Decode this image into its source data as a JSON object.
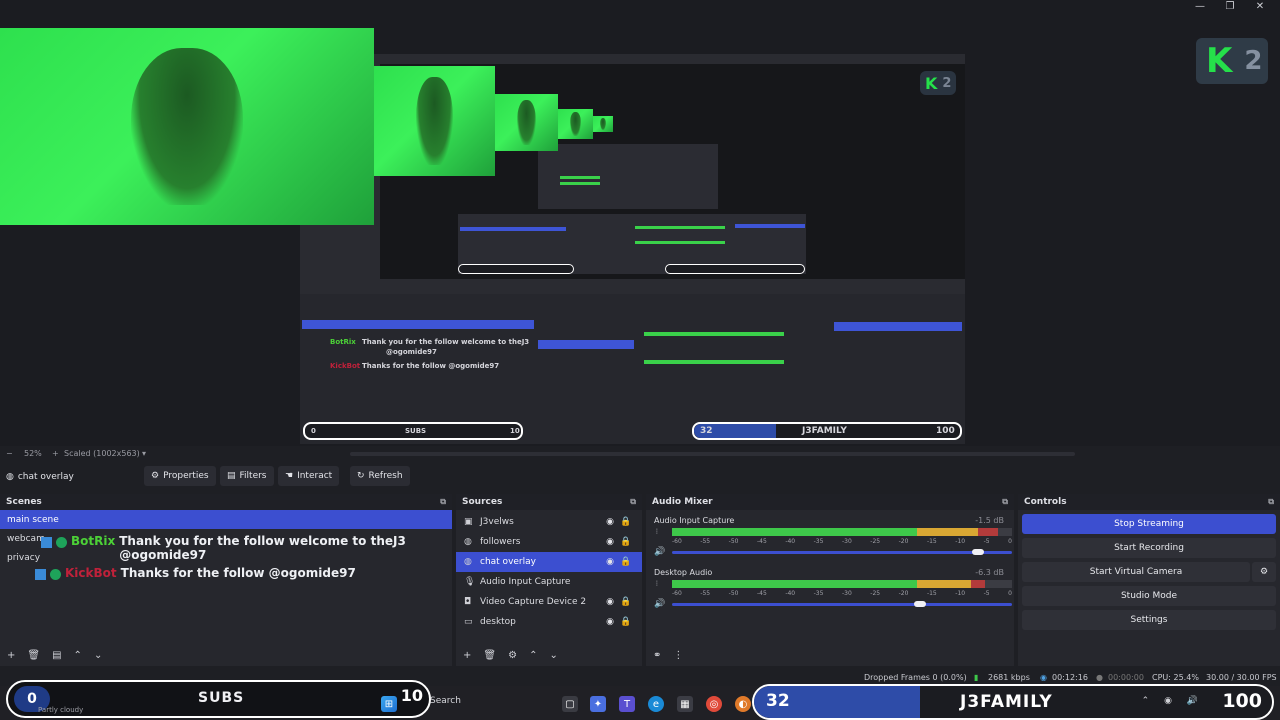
{
  "window_controls": [
    "—",
    "❐",
    "✕"
  ],
  "kick_badge": {
    "letter": "K",
    "number": "2"
  },
  "preview": {
    "zoom": "52%",
    "scale": "Scaled (1002x563)"
  },
  "source_toolbar": {
    "selected_source": "chat overlay",
    "properties": "Properties",
    "filters": "Filters",
    "interact": "Interact",
    "refresh": "Refresh"
  },
  "scenes": {
    "title": "Scenes",
    "items": [
      {
        "label": "main scene",
        "active": true
      },
      {
        "label": "webcam",
        "active": false
      },
      {
        "label": "privacy",
        "active": false
      }
    ]
  },
  "chat": [
    {
      "user": "BotRix",
      "user_color": "#4cd137",
      "message": "Thank you for the follow welcome to theJ3",
      "message2": "@ogomide97"
    },
    {
      "user": "KickBot",
      "user_color": "#c0213a",
      "message": "Thanks for the follow @ogomide97"
    }
  ],
  "sources": {
    "title": "Sources",
    "items": [
      {
        "label": "J3velws",
        "icon": "window-icon",
        "active": false
      },
      {
        "label": "followers",
        "icon": "globe-icon",
        "active": false
      },
      {
        "label": "chat overlay",
        "icon": "globe-icon",
        "active": true
      },
      {
        "label": "Audio Input Capture",
        "icon": "mic-icon",
        "active": false
      },
      {
        "label": "Video Capture Device 2",
        "icon": "camera-icon",
        "active": false
      },
      {
        "label": "desktop",
        "icon": "monitor-icon",
        "active": false
      }
    ]
  },
  "mixer": {
    "title": "Audio Mixer",
    "scale_labels": [
      "-60",
      "-55",
      "-50",
      "-45",
      "-40",
      "-35",
      "-30",
      "-25",
      "-20",
      "-15",
      "-10",
      "-5",
      "0"
    ],
    "channels": [
      {
        "name": "Audio Input Capture",
        "db": "-1.5 dB",
        "level": 0.92,
        "volume": 0.9
      },
      {
        "name": "Desktop Audio",
        "db": "-6.3 dB",
        "level": 0.88,
        "volume": 0.73
      }
    ]
  },
  "controls": {
    "title": "Controls",
    "buttons": [
      {
        "label": "Stop Streaming",
        "active": true
      },
      {
        "label": "Start Recording",
        "active": false
      },
      {
        "label": "Start Virtual Camera",
        "active": false
      },
      {
        "label": "Studio Mode",
        "active": false
      },
      {
        "label": "Settings",
        "active": false
      }
    ]
  },
  "status": {
    "dropped": "Dropped Frames 0 (0.0%)",
    "bitrate": "2681 kbps",
    "stream_time": "00:12:16",
    "rec_time": "00:00:00",
    "cpu": "CPU: 25.4%",
    "fps": "30.00 / 30.00 FPS"
  },
  "subs_widget": {
    "left_count": "0",
    "label": "SUBS",
    "right_count": "10",
    "weather": "Partly cloudy"
  },
  "taskbar": {
    "search": "Search"
  },
  "goal_widget": {
    "left_count": "32",
    "label": "J3FAMILY",
    "right_count": "100",
    "progress": 0.32
  },
  "nested_preview": {
    "chat_user1": "BotRix",
    "chat_msg1": "Thank you for the follow welcome to theJ3",
    "chat_msg1b": "@ogomide97",
    "chat_user2": "KickBot",
    "chat_msg2": "Thanks for the follow @ogomide97",
    "goal_left": "32",
    "goal_label": "J3FAMILY",
    "goal_right": "100",
    "subs_label": "SUBS",
    "subs_right": "10",
    "subs_left": "0",
    "kick_letter": "K",
    "kick_number": "2"
  },
  "colors": {
    "accent": "#3c4fd0",
    "meter_green": "#3ec84a",
    "meter_yellow": "#d9a733",
    "meter_red": "#b33b3b",
    "webcam_green": "#2ee04e"
  }
}
